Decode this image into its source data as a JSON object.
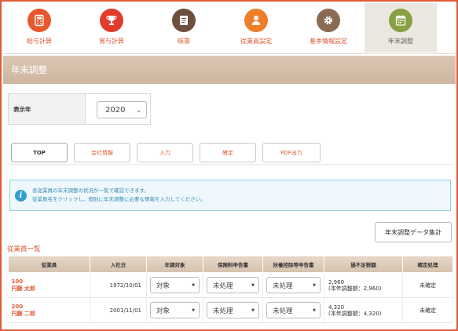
{
  "nav": {
    "items": [
      {
        "label": "給与計算",
        "icon": "calculator-icon",
        "color": "#e8582e",
        "active": false
      },
      {
        "label": "賞与計算",
        "icon": "trophy-icon",
        "color": "#e23b2b",
        "active": false
      },
      {
        "label": "帳票",
        "icon": "document-icon",
        "color": "#6e4f3e",
        "active": false
      },
      {
        "label": "従業員設定",
        "icon": "person-icon",
        "color": "#ee7f28",
        "active": false
      },
      {
        "label": "基本情報設定",
        "icon": "gear-icon",
        "color": "#8a6a52",
        "active": false
      },
      {
        "label": "年末調整",
        "icon": "calendar-icon",
        "color": "#86a043",
        "active": true
      }
    ]
  },
  "page": {
    "title": "年末調整"
  },
  "year": {
    "label": "表示年",
    "value": "2020"
  },
  "tabs": [
    {
      "label": "TOP",
      "active": true
    },
    {
      "label": "会社情報",
      "active": false
    },
    {
      "label": "入力",
      "active": false
    },
    {
      "label": "確定",
      "active": false
    },
    {
      "label": "PDF出力",
      "active": false
    }
  ],
  "info": {
    "line1": "各従業員の年末調整の状況が一覧で確認できます。",
    "line2": "従業員名をクリックし、個別に年末調整に必要な情報を入力してください。"
  },
  "aggregate_button": "年末調整データ集計",
  "section_title": "従業員一覧",
  "table": {
    "headers": [
      "従業員",
      "入社日",
      "年調対象",
      "保険料申告書",
      "扶養控除等申告書",
      "過不足税額",
      "確定処理"
    ],
    "rows": [
      {
        "id": "100",
        "name": "円藤 太郎",
        "hire_date": "1972/10/01",
        "target": "対象",
        "insurance": "未処理",
        "dependent": "未処理",
        "shortage": "2,960",
        "shortage_note": "(本年調整額：2,960)",
        "status": "未確定"
      },
      {
        "id": "200",
        "name": "円藤 二郎",
        "hire_date": "2001/11/01",
        "target": "対象",
        "insurance": "未処理",
        "dependent": "未処理",
        "shortage": "4,320",
        "shortage_note": "(本年調整額：4,320)",
        "status": "未確定"
      }
    ]
  }
}
